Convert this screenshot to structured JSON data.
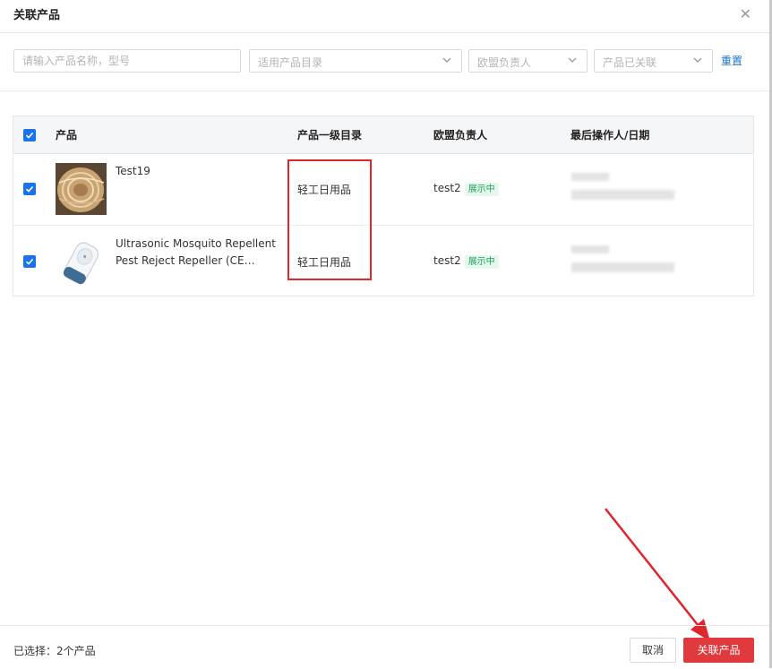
{
  "dialog": {
    "title": "关联产品"
  },
  "filters": {
    "search_placeholder": "请输入产品名称，型号",
    "category_placeholder": "适用产品目录",
    "owner_placeholder": "欧盟负责人",
    "status_placeholder": "产品已关联",
    "reset_label": "重置"
  },
  "table": {
    "columns": [
      "产品",
      "产品一级目录",
      "欧盟负责人",
      "最后操作人/日期"
    ],
    "rows": [
      {
        "name": "Test19",
        "category": "轻工日用品",
        "owner": "test2",
        "badge": "展示中",
        "checked": true
      },
      {
        "name": "Ultrasonic Mosquito Repellent Pest Reject Repeller (CE…",
        "category": "轻工日用品",
        "owner": "test2",
        "badge": "展示中",
        "checked": true
      }
    ]
  },
  "footer": {
    "selected_text": "已选择：2个产品",
    "cancel_label": "取消",
    "confirm_label": "关联产品"
  },
  "colors": {
    "primary": "#1a73e8",
    "danger": "#e0393e",
    "badge_text": "#1ea35a",
    "annotation": "#e0262c"
  }
}
